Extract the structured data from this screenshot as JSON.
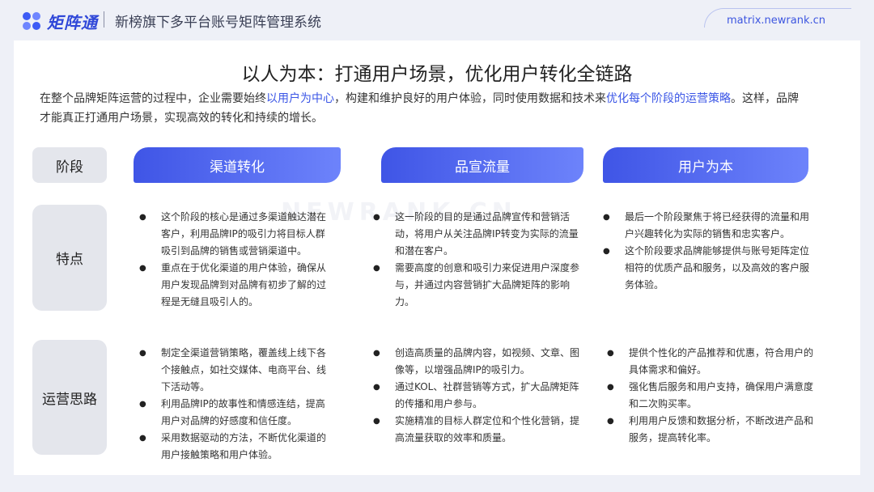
{
  "header": {
    "logo_text": "矩阵通",
    "subtitle": "新榜旗下多平台账号矩阵管理系统",
    "site": "matrix.newrank.cn"
  },
  "watermark": "NEWRANK.CN",
  "main": {
    "title": "以人为本：打通用户场景，优化用户转化全链路",
    "intro": {
      "part1": "在整个品牌矩阵运营的过程中，企业需要始终",
      "hl1": "以用户为中心",
      "part2": "，构建和维护良好的用户体验，同时使用数据和技术来",
      "hl2": "优化每个阶段的运营策略",
      "part3": "。这样，品牌才能真正打通用户场景，实现高效的转化和持续的增长。"
    }
  },
  "table": {
    "stage_header": "阶段",
    "columns": [
      "渠道转化",
      "品宣流量",
      "用户为本"
    ],
    "rows": [
      {
        "label": "特点",
        "cells": [
          [
            "这个阶段的核心是通过多渠道触达潜在客户，利用品牌IP的吸引力将目标人群吸引到品牌的销售或营销渠道中。",
            "重点在于优化渠道的用户体验，确保从用户发现品牌到对品牌有初步了解的过程是无缝且吸引人的。"
          ],
          [
            "这一阶段的目的是通过品牌宣传和营销活动，将用户从关注品牌IP转变为实际的流量和潜在客户。",
            "需要高度的创意和吸引力来促进用户深度参与，并通过内容营销扩大品牌矩阵的影响力。"
          ],
          [
            "最后一个阶段聚焦于将已经获得的流量和用户兴趣转化为实际的销售和忠实客户。",
            "这个阶段要求品牌能够提供与账号矩阵定位相符的优质产品和服务，以及高效的客户服务体验。"
          ]
        ]
      },
      {
        "label": "运营思路",
        "cells": [
          [
            "制定全渠道营销策略，覆盖线上线下各个接触点，如社交媒体、电商平台、线下活动等。",
            "利用品牌IP的故事性和情感连结，提高用户对品牌的好感度和信任度。",
            "采用数据驱动的方法，不断优化渠道的用户接触策略和用户体验。"
          ],
          [
            "创造高质量的品牌内容，如视频、文章、图像等，以增强品牌IP的吸引力。",
            "通过KOL、社群营销等方式，扩大品牌矩阵的传播和用户参与。",
            "实施精准的目标人群定位和个性化营销，提高流量获取的效率和质量。"
          ],
          [
            "提供个性化的产品推荐和优惠，符合用户的具体需求和偏好。",
            "强化售后服务和用户支持，确保用户满意度和二次购买率。",
            "利用用户反馈和数据分析，不断改进产品和服务，提高转化率。"
          ]
        ]
      }
    ]
  }
}
